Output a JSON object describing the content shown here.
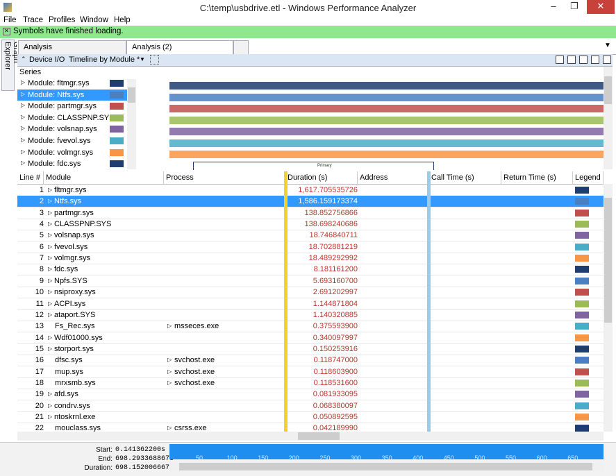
{
  "window": {
    "title": "C:\\temp\\usbdrive.etl - Windows Performance Analyzer"
  },
  "menu": [
    "File",
    "Trace",
    "Profiles",
    "Window",
    "Help"
  ],
  "notification": "Symbols have finished loading.",
  "side_tab": "Graph Explorer",
  "tabs": [
    {
      "label": "Analysis"
    },
    {
      "label": "Analysis (2)"
    }
  ],
  "view": {
    "category": "Device I/O",
    "preset": "Timeline by Module *"
  },
  "series": {
    "header": "Series",
    "items": [
      {
        "label": "Module: fltmgr.sys",
        "color": "#1f3d6e"
      },
      {
        "label": "Module: Ntfs.sys",
        "color": "#4a7fc1"
      },
      {
        "label": "Module: partmgr.sys",
        "color": "#c0504d"
      },
      {
        "label": "Module: CLASSPNP.SYS",
        "color": "#9bbb59"
      },
      {
        "label": "Module: volsnap.sys",
        "color": "#8064a2"
      },
      {
        "label": "Module: fvevol.sys",
        "color": "#4bacc6"
      },
      {
        "label": "Module: volmgr.sys",
        "color": "#f79646"
      },
      {
        "label": "Module: fdc.sys",
        "color": "#1f3d6e"
      }
    ]
  },
  "graph": {
    "primary_label": "Primary"
  },
  "table": {
    "headers": [
      "Line #",
      "Module",
      "Process",
      "Duration (s)",
      "Address",
      "Call Time (s)",
      "Return Time (s)",
      "Legend"
    ],
    "rows": [
      {
        "line": "1",
        "module": "fltmgr.sys",
        "process": "",
        "duration": "1,617.705535726",
        "color": "#1f3d6e"
      },
      {
        "line": "2",
        "module": "Ntfs.sys",
        "process": "",
        "duration": "1,586.159173374",
        "color": "#4a7fc1"
      },
      {
        "line": "3",
        "module": "partmgr.sys",
        "process": "",
        "duration": "138.852756866",
        "color": "#c0504d"
      },
      {
        "line": "4",
        "module": "CLASSPNP.SYS",
        "process": "",
        "duration": "138.698240686",
        "color": "#9bbb59"
      },
      {
        "line": "5",
        "module": "volsnap.sys",
        "process": "",
        "duration": "18.746840711",
        "color": "#8064a2"
      },
      {
        "line": "6",
        "module": "fvevol.sys",
        "process": "",
        "duration": "18.702881219",
        "color": "#4bacc6"
      },
      {
        "line": "7",
        "module": "volmgr.sys",
        "process": "",
        "duration": "18.489292992",
        "color": "#f79646"
      },
      {
        "line": "8",
        "module": "fdc.sys",
        "process": "",
        "duration": "8.181161200",
        "color": "#1f3d6e"
      },
      {
        "line": "9",
        "module": "Npfs.SYS",
        "process": "",
        "duration": "5.693160700",
        "color": "#4a7fc1"
      },
      {
        "line": "10",
        "module": "nsiproxy.sys",
        "process": "",
        "duration": "2.691202997",
        "color": "#c0504d"
      },
      {
        "line": "11",
        "module": "ACPI.sys",
        "process": "",
        "duration": "1.144871804",
        "color": "#9bbb59"
      },
      {
        "line": "12",
        "module": "ataport.SYS",
        "process": "",
        "duration": "1.140320885",
        "color": "#8064a2"
      },
      {
        "line": "13",
        "module": "Fs_Rec.sys",
        "process": "msseces.exe",
        "duration": "0.375593900",
        "color": "#4bacc6"
      },
      {
        "line": "14",
        "module": "Wdf01000.sys",
        "process": "",
        "duration": "0.340097997",
        "color": "#f79646"
      },
      {
        "line": "15",
        "module": "storport.sys",
        "process": "",
        "duration": "0.150253916",
        "color": "#1f3d6e"
      },
      {
        "line": "16",
        "module": "dfsc.sys",
        "process": "svchost.exe",
        "duration": "0.118747000",
        "color": "#4a7fc1"
      },
      {
        "line": "17",
        "module": "mup.sys",
        "process": "svchost.exe",
        "duration": "0.118603900",
        "color": "#c0504d"
      },
      {
        "line": "18",
        "module": "mrxsmb.sys",
        "process": "svchost.exe",
        "duration": "0.118531600",
        "color": "#9bbb59"
      },
      {
        "line": "19",
        "module": "afd.sys",
        "process": "",
        "duration": "0.081933095",
        "color": "#8064a2"
      },
      {
        "line": "20",
        "module": "condrv.sys",
        "process": "",
        "duration": "0.068380097",
        "color": "#4bacc6"
      },
      {
        "line": "21",
        "module": "ntoskrnl.exe",
        "process": "",
        "duration": "0.050892595",
        "color": "#f79646"
      },
      {
        "line": "22",
        "module": "mouclass.sys",
        "process": "csrss.exe",
        "duration": "0.042189990",
        "color": "#1f3d6e"
      }
    ]
  },
  "timeline": {
    "start_label": "Start:",
    "start": "0.141362200s",
    "end_label": "End:",
    "end": "698.293368867s",
    "duration_label": "Duration:",
    "duration": "698.152006667s",
    "ticks": [
      "50",
      "100",
      "150",
      "200",
      "250",
      "300",
      "350",
      "400",
      "450",
      "500",
      "550",
      "600",
      "650"
    ]
  }
}
